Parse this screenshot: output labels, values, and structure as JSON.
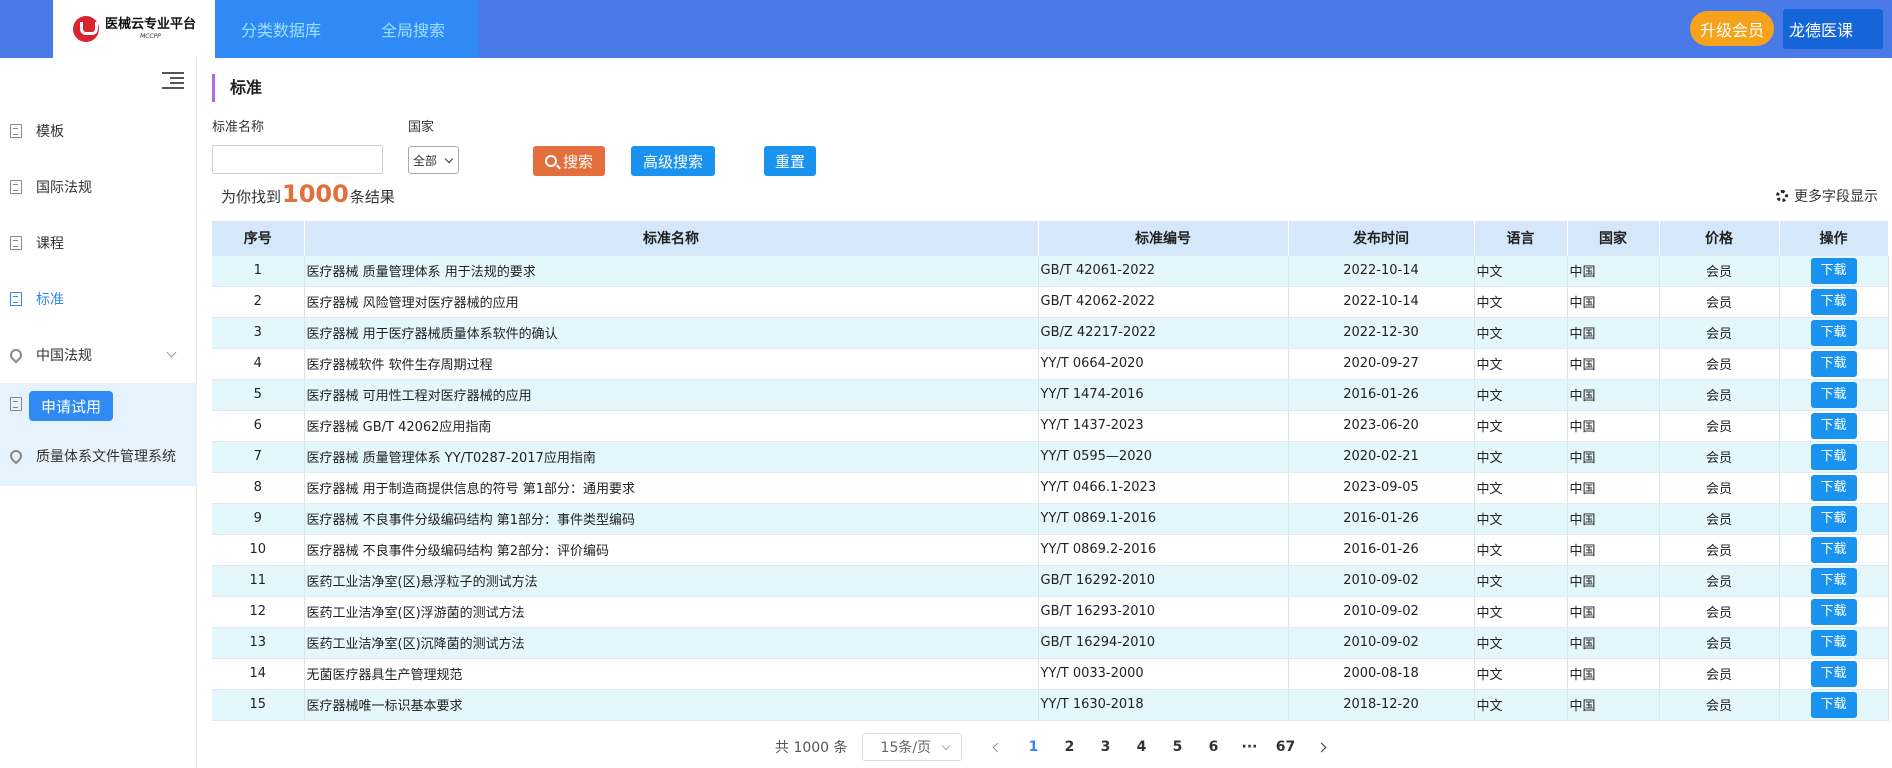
{
  "header": {
    "logo_title": "医械云专业平台",
    "logo_sub": "MCCPP",
    "nav": [
      "分类数据库",
      "全局搜索"
    ],
    "upgrade_label": "升级会员",
    "user_label": "龙德医课"
  },
  "sidebar": {
    "items": [
      {
        "label": "模板",
        "icon": "document-icon"
      },
      {
        "label": "国际法规",
        "icon": "document-icon"
      },
      {
        "label": "课程",
        "icon": "document-icon"
      },
      {
        "label": "标准",
        "icon": "document-icon",
        "active": true
      },
      {
        "label": "中国法规",
        "icon": "location-pin-icon"
      },
      {
        "label": "质量体系文件管理系统",
        "icon": "location-pin-icon"
      }
    ],
    "trial_label": "申请试用"
  },
  "main": {
    "title": "标准",
    "filters": {
      "name_label": "标准名称",
      "name_value": "",
      "country_label": "国家",
      "country_value": "全部"
    },
    "buttons": {
      "search": "搜索",
      "advanced": "高级搜索",
      "reset": "重置"
    },
    "result_prefix": "为你找到",
    "result_count": "1000",
    "result_suffix": "条结果",
    "more_fields": "更多字段显示"
  },
  "table": {
    "headers": [
      "序号",
      "标准名称",
      "标准编号",
      "发布时间",
      "语言",
      "国家",
      "价格",
      "操作"
    ],
    "rows": [
      {
        "no": "1",
        "name": "医疗器械 质量管理体系 用于法规的要求",
        "code": "GB/T 42061-2022",
        "date": "2022-10-14",
        "lang": "中文",
        "country": "中国",
        "price": "会员",
        "op": "下载"
      },
      {
        "no": "2",
        "name": "医疗器械 风险管理对医疗器械的应用",
        "code": "GB/T 42062-2022",
        "date": "2022-10-14",
        "lang": "中文",
        "country": "中国",
        "price": "会员",
        "op": "下载"
      },
      {
        "no": "3",
        "name": "医疗器械 用于医疗器械质量体系软件的确认",
        "code": "GB/Z 42217-2022",
        "date": "2022-12-30",
        "lang": "中文",
        "country": "中国",
        "price": "会员",
        "op": "下载"
      },
      {
        "no": "4",
        "name": "医疗器械软件 软件生存周期过程",
        "code": "YY/T 0664-2020",
        "date": "2020-09-27",
        "lang": "中文",
        "country": "中国",
        "price": "会员",
        "op": "下载"
      },
      {
        "no": "5",
        "name": "医疗器械 可用性工程对医疗器械的应用",
        "code": "YY/T 1474-2016",
        "date": "2016-01-26",
        "lang": "中文",
        "country": "中国",
        "price": "会员",
        "op": "下载"
      },
      {
        "no": "6",
        "name": "医疗器械 GB/T 42062应用指南",
        "code": "YY/T 1437-2023",
        "date": "2023-06-20",
        "lang": "中文",
        "country": "中国",
        "price": "会员",
        "op": "下载"
      },
      {
        "no": "7",
        "name": "医疗器械 质量管理体系 YY/T0287-2017应用指南",
        "code": "YY/T 0595—2020",
        "date": "2020-02-21",
        "lang": "中文",
        "country": "中国",
        "price": "会员",
        "op": "下载"
      },
      {
        "no": "8",
        "name": "医疗器械 用于制造商提供信息的符号 第1部分：通用要求",
        "code": "YY/T 0466.1-2023",
        "date": "2023-09-05",
        "lang": "中文",
        "country": "中国",
        "price": "会员",
        "op": "下载"
      },
      {
        "no": "9",
        "name": "医疗器械 不良事件分级编码结构 第1部分：事件类型编码",
        "code": "YY/T 0869.1-2016",
        "date": "2016-01-26",
        "lang": "中文",
        "country": "中国",
        "price": "会员",
        "op": "下载"
      },
      {
        "no": "10",
        "name": "医疗器械 不良事件分级编码结构 第2部分：评价编码",
        "code": "YY/T 0869.2-2016",
        "date": "2016-01-26",
        "lang": "中文",
        "country": "中国",
        "price": "会员",
        "op": "下载"
      },
      {
        "no": "11",
        "name": "医药工业洁净室(区)悬浮粒子的测试方法",
        "code": "GB/T 16292-2010",
        "date": "2010-09-02",
        "lang": "中文",
        "country": "中国",
        "price": "会员",
        "op": "下载"
      },
      {
        "no": "12",
        "name": "医药工业洁净室(区)浮游菌的测试方法",
        "code": "GB/T 16293-2010",
        "date": "2010-09-02",
        "lang": "中文",
        "country": "中国",
        "price": "会员",
        "op": "下载"
      },
      {
        "no": "13",
        "name": "医药工业洁净室(区)沉降菌的测试方法",
        "code": "GB/T 16294-2010",
        "date": "2010-09-02",
        "lang": "中文",
        "country": "中国",
        "price": "会员",
        "op": "下载"
      },
      {
        "no": "14",
        "name": "无菌医疗器具生产管理规范",
        "code": "YY/T 0033-2000",
        "date": "2000-08-18",
        "lang": "中文",
        "country": "中国",
        "price": "会员",
        "op": "下载"
      },
      {
        "no": "15",
        "name": "医疗器械唯一标识基本要求",
        "code": "YY/T 1630-2018",
        "date": "2018-12-20",
        "lang": "中文",
        "country": "中国",
        "price": "会员",
        "op": "下载"
      }
    ]
  },
  "pagination": {
    "total_label": "共 1000 条",
    "page_size": "15条/页",
    "pages": [
      "1",
      "2",
      "3",
      "4",
      "5",
      "6",
      "···",
      "67"
    ],
    "current": "1"
  },
  "colors": {
    "topbar": "#4a7ae8",
    "accent": "#2f8af5",
    "search_button": "#e26f3c",
    "upgrade_button": "#f7a21b"
  }
}
